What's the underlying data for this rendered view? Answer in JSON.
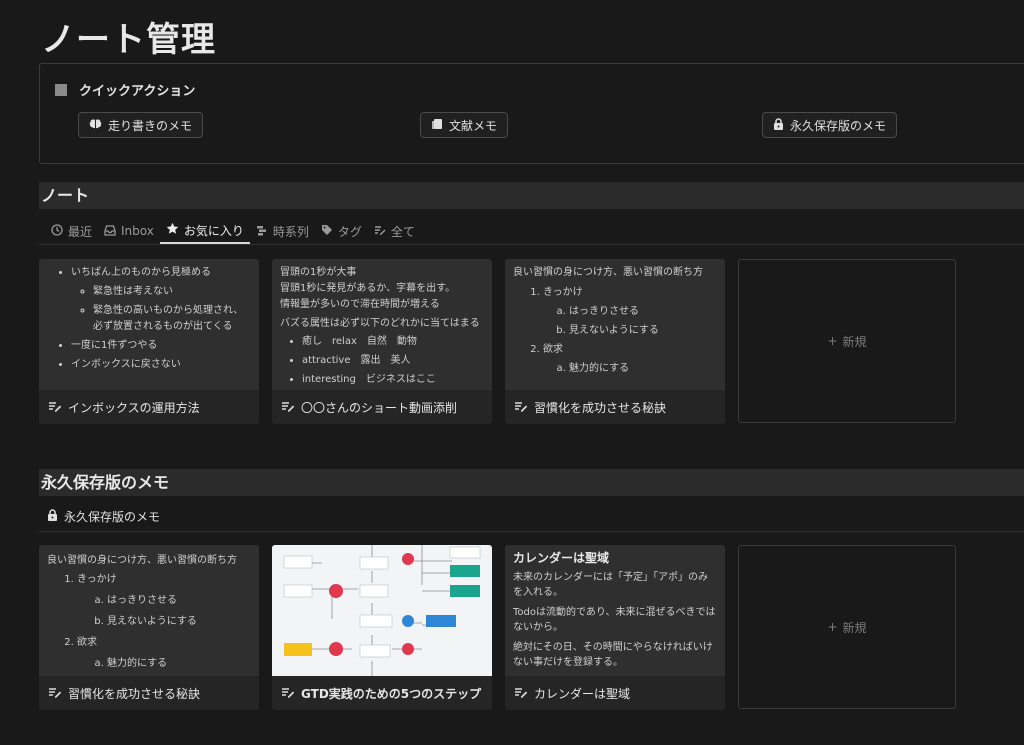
{
  "page": {
    "title": "ノート管理"
  },
  "quick_actions": {
    "heading": "クイックアクション",
    "buttons": [
      {
        "label": "走り書きのメモ",
        "icon": "brain-icon"
      },
      {
        "label": "文献メモ",
        "icon": "book-icon"
      },
      {
        "label": "永久保存版のメモ",
        "icon": "lock-icon"
      }
    ]
  },
  "notes_section": {
    "heading": "ノート",
    "tabs": [
      {
        "label": "最近",
        "icon": "clock-icon"
      },
      {
        "label": "Inbox",
        "icon": "inbox-icon"
      },
      {
        "label": "お気に入り",
        "icon": "star-icon",
        "active": true
      },
      {
        "label": "時系列",
        "icon": "timeline-icon"
      },
      {
        "label": "タグ",
        "icon": "tag-icon"
      },
      {
        "label": "全て",
        "icon": "note-icon"
      }
    ],
    "cards": [
      {
        "title": "インボックスの運用方法",
        "lines": [
          "いちばん上のものから見極める",
          "緊急性は考えない",
          "緊急性の高いものから処理され、必ず放置されるものが出てくる",
          "一度に1件ずつやる",
          "インボックスに戻さない"
        ]
      },
      {
        "title": "〇〇さんのショート動画添削",
        "lines": [
          "冒頭の1秒が大事",
          "冒頭1秒に発見があるか、字幕を出す。",
          "情報量が多いので滞在時間が増える",
          "バズる属性は必ず以下のどれかに当てはまる",
          "癒し　relax　自然　動物",
          "attractive　露出　美人",
          "interesting　ビジネスはここ"
        ]
      },
      {
        "title": "習慣化を成功させる秘訣",
        "lines": [
          "良い習慣の身につけ方、悪い習慣の断ち方",
          "きっかけ",
          "はっきりさせる",
          "見えないようにする",
          "欲求",
          "魅力的にする"
        ]
      }
    ],
    "new_label": "新規"
  },
  "permanent_section": {
    "heading": "永久保存版のメモ",
    "subheading": "永久保存版のメモ",
    "cards": [
      {
        "title": "習慣化を成功させる秘訣",
        "lines": [
          "良い習慣の身につけ方、悪い習慣の断ち方",
          "きっかけ",
          "はっきりさせる",
          "見えないようにする",
          "欲求",
          "魅力的にする"
        ]
      },
      {
        "title": "GTD実践のための5つのステップ"
      },
      {
        "title": "カレンダーは聖域",
        "lines": [
          "カレンダーは聖域",
          "未来のカレンダーには「予定」「アポ」のみを入れる。",
          "Todoは流動的であり、未来に混ぜるべきではないから。",
          "絶対にその日、その時間にやらなければいけない事だけを登録する。"
        ]
      }
    ],
    "new_label": "新規"
  },
  "colors": {
    "bg": "#191919",
    "card": "#2f2f2f",
    "diagram_red": "#e0384f",
    "diagram_teal": "#1aa58f",
    "diagram_blue": "#2f86d6",
    "diagram_yellow": "#f5c21b"
  }
}
